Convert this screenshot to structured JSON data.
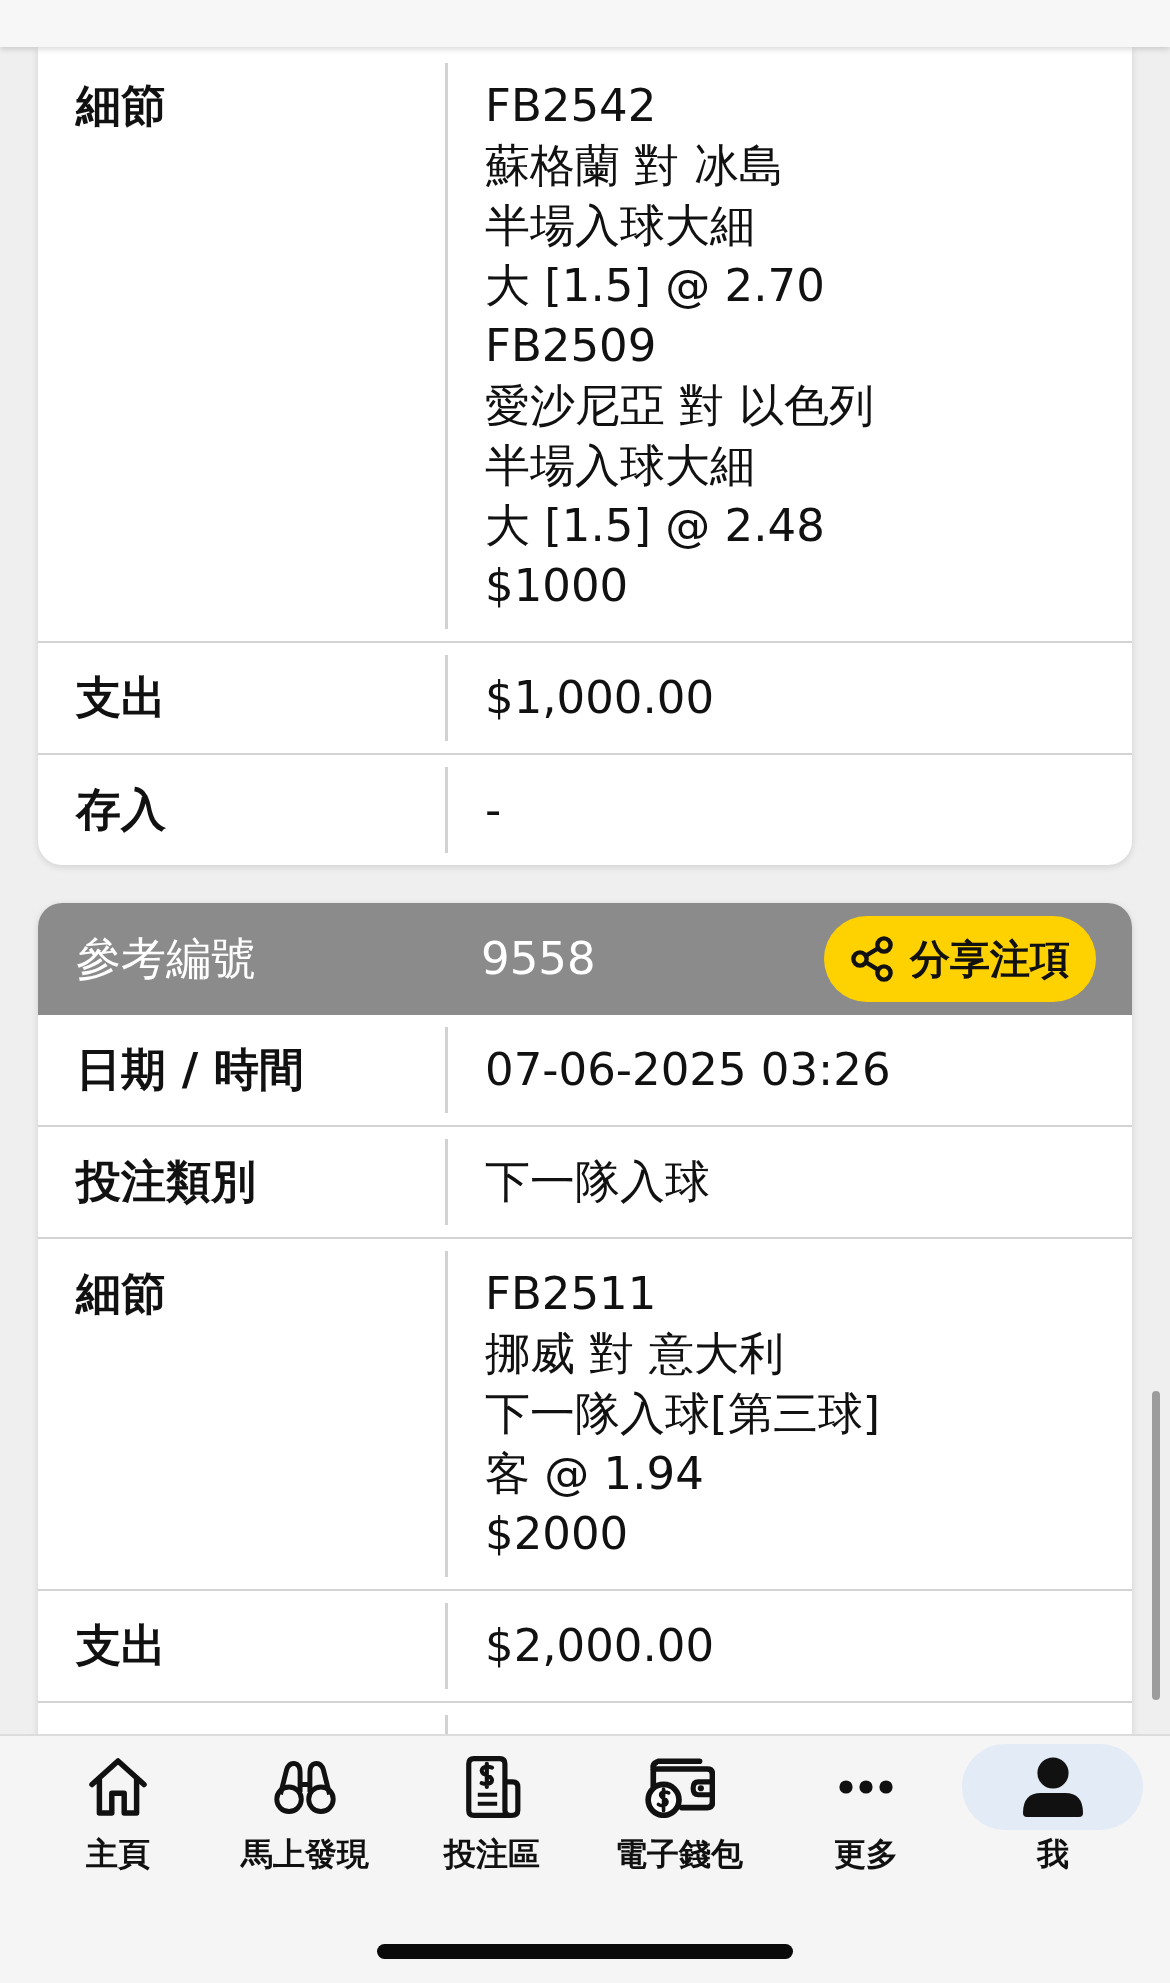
{
  "records": [
    {
      "rows": [
        {
          "label": "細節",
          "lines": [
            "FB2542",
            "蘇格蘭 對 冰島",
            "半場入球大細",
            "大 [1.5] @ 2.70",
            "FB2509",
            "愛沙尼亞 對 以色列",
            "半場入球大細",
            "大 [1.5] @ 2.48",
            "$1000"
          ]
        },
        {
          "label": "支出",
          "value": "$1,000.00"
        },
        {
          "label": "存入",
          "value": "-"
        }
      ]
    },
    {
      "header": {
        "label": "參考編號",
        "value": "9558",
        "share_button": "分享注項"
      },
      "rows": [
        {
          "label": "日期 / 時間",
          "value": "07-06-2025 03:26"
        },
        {
          "label": "投注類別",
          "value": "下一隊入球"
        },
        {
          "label": "細節",
          "lines": [
            "FB2511",
            "挪威 對 意大利",
            "下一隊入球[第三球]",
            "客 @ 1.94",
            "$2000"
          ]
        },
        {
          "label": "支出",
          "value": "$2,000.00"
        }
      ]
    }
  ],
  "nav_items": [
    {
      "label": "主頁",
      "selected": false
    },
    {
      "label": "馬上發現",
      "selected": false
    },
    {
      "label": "投注區",
      "selected": false
    },
    {
      "label": "電子錢包",
      "selected": false
    },
    {
      "label": "更多",
      "selected": false
    },
    {
      "label": "我",
      "selected": true
    }
  ]
}
